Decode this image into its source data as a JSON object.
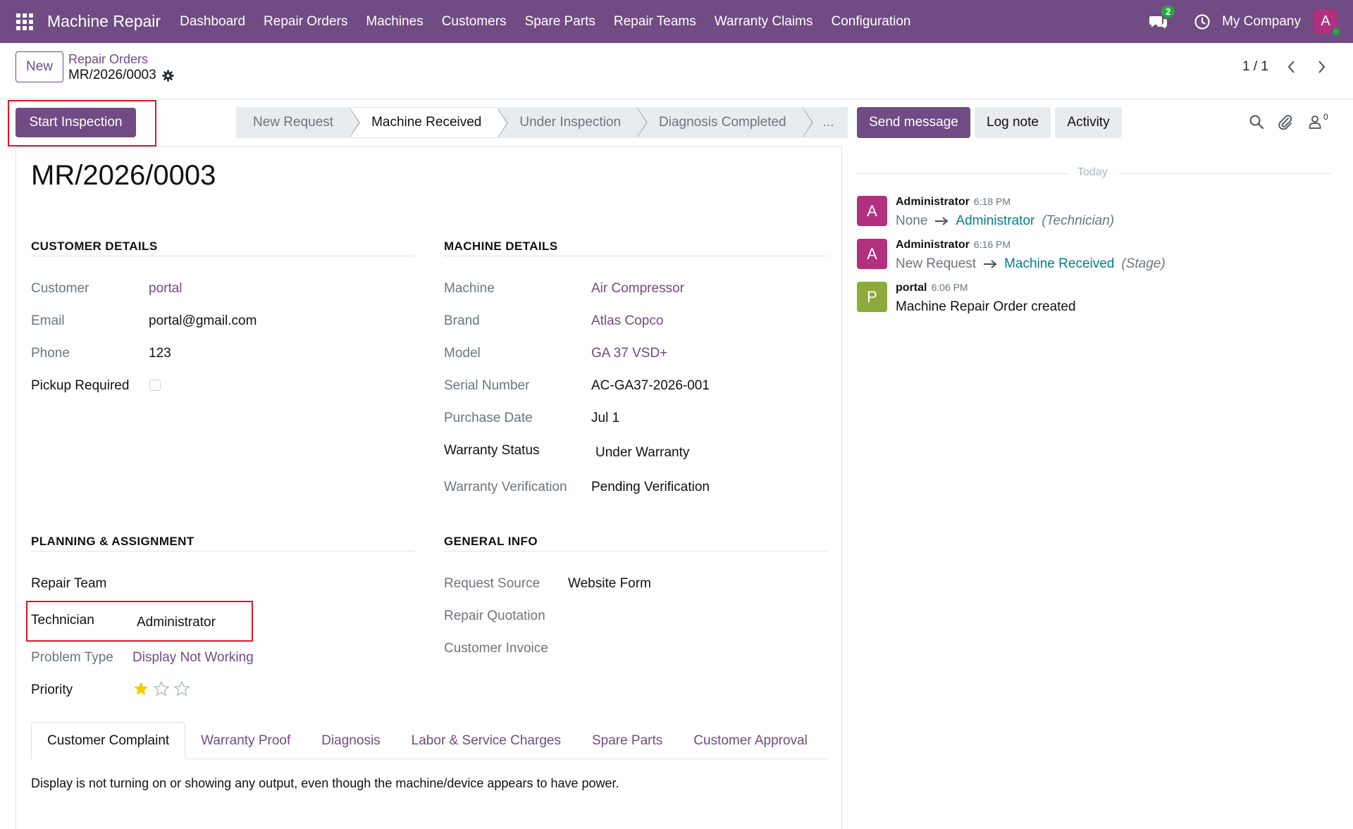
{
  "app": {
    "name": "Machine Repair",
    "menu": [
      "Dashboard",
      "Repair Orders",
      "Machines",
      "Customers",
      "Spare Parts",
      "Repair Teams",
      "Warranty Claims",
      "Configuration"
    ],
    "messages_count": "2",
    "company": "My Company",
    "user_initial": "A"
  },
  "control": {
    "new_label": "New",
    "breadcrumb_parent": "Repair Orders",
    "breadcrumb_current": "MR/2026/0003",
    "pager": "1 / 1"
  },
  "actions": {
    "primary": "Start Inspection"
  },
  "statusbar": {
    "stages": [
      "New Request",
      "Machine Received",
      "Under Inspection",
      "Diagnosis Completed",
      "..."
    ],
    "active": "Machine Received"
  },
  "record": {
    "title": "MR/2026/0003",
    "customer_details": {
      "heading": "CUSTOMER DETAILS",
      "customer_label": "Customer",
      "customer": "portal",
      "email_label": "Email",
      "email": "portal@gmail.com",
      "phone_label": "Phone",
      "phone": "123",
      "pickup_label": "Pickup Required",
      "pickup": false
    },
    "machine_details": {
      "heading": "MACHINE DETAILS",
      "machine_label": "Machine",
      "machine": "Air Compressor",
      "brand_label": "Brand",
      "brand": "Atlas Copco",
      "model_label": "Model",
      "model": "GA 37 VSD+",
      "serial_label": "Serial Number",
      "serial": "AC-GA37-2026-001",
      "purchase_label": "Purchase Date",
      "purchase": "Jul 1",
      "warranty_status_label": "Warranty Status",
      "warranty_status": "Under Warranty",
      "warranty_verification_label": "Warranty Verification",
      "warranty_verification": "Pending Verification"
    },
    "planning": {
      "heading": "PLANNING & ASSIGNMENT",
      "team_label": "Repair Team",
      "technician_label": "Technician",
      "technician": "Administrator",
      "problem_label": "Problem Type",
      "problem": "Display Not Working",
      "priority_label": "Priority",
      "priority_stars": 1,
      "priority_max": 3
    },
    "general_info": {
      "heading": "GENERAL INFO",
      "source_label": "Request Source",
      "source": "Website Form",
      "quotation_label": "Repair Quotation",
      "invoice_label": "Customer Invoice"
    },
    "tabs": [
      "Customer Complaint",
      "Warranty Proof",
      "Diagnosis",
      "Labor & Service Charges",
      "Spare Parts",
      "Customer Approval"
    ],
    "active_tab": "Customer Complaint",
    "complaint": "Display is not turning on or showing any output, even though the machine/device appears to have power."
  },
  "chatter": {
    "send_message": "Send message",
    "log_note": "Log note",
    "activity": "Activity",
    "followers": "0",
    "today": "Today",
    "messages": [
      {
        "initial": "A",
        "author": "Administrator",
        "time": "6:18 PM",
        "old": "None",
        "new": "Administrator",
        "field": "(Technician)",
        "color": "#b1317f"
      },
      {
        "initial": "A",
        "author": "Administrator",
        "time": "6:16 PM",
        "old": "New Request",
        "new": "Machine Received",
        "field": "(Stage)",
        "color": "#b1317f"
      },
      {
        "initial": "P",
        "author": "portal",
        "time": "6:06 PM",
        "body": "Machine Repair Order created",
        "color": "#8dab3c"
      }
    ]
  },
  "colors": {
    "brand": "#714b83",
    "highlight": "#e0142b",
    "link_teal": "#017e84",
    "star": "#f3cc00"
  }
}
